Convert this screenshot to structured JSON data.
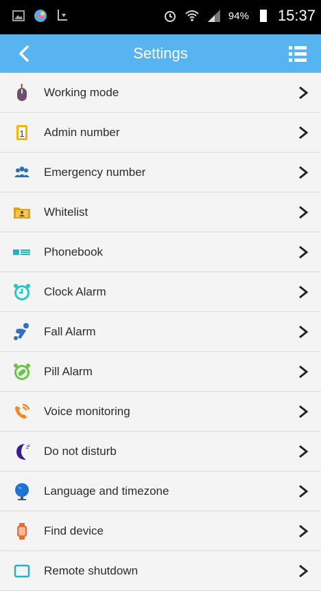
{
  "status_bar": {
    "battery": "94%",
    "time": "15:37"
  },
  "header": {
    "title": "Settings"
  },
  "items": [
    {
      "label": "Working mode",
      "icon": "mouse-icon"
    },
    {
      "label": "Admin number",
      "icon": "admin-number-icon"
    },
    {
      "label": "Emergency number",
      "icon": "people-icon"
    },
    {
      "label": "Whitelist",
      "icon": "folder-contact-icon"
    },
    {
      "label": "Phonebook",
      "icon": "phonebook-icon"
    },
    {
      "label": "Clock Alarm",
      "icon": "alarm-clock-icon"
    },
    {
      "label": "Fall Alarm",
      "icon": "fall-icon"
    },
    {
      "label": "Pill Alarm",
      "icon": "pill-alarm-icon"
    },
    {
      "label": "Voice monitoring",
      "icon": "voice-monitor-icon"
    },
    {
      "label": "Do not disturb",
      "icon": "moon-icon"
    },
    {
      "label": "Language and timezone",
      "icon": "globe-icon"
    },
    {
      "label": "Find device",
      "icon": "watch-icon"
    },
    {
      "label": "Remote shutdown",
      "icon": "power-icon"
    }
  ],
  "colors": {
    "appbar": "#58b4f0",
    "statusbar": "#000000",
    "background": "#f4f4f4"
  }
}
